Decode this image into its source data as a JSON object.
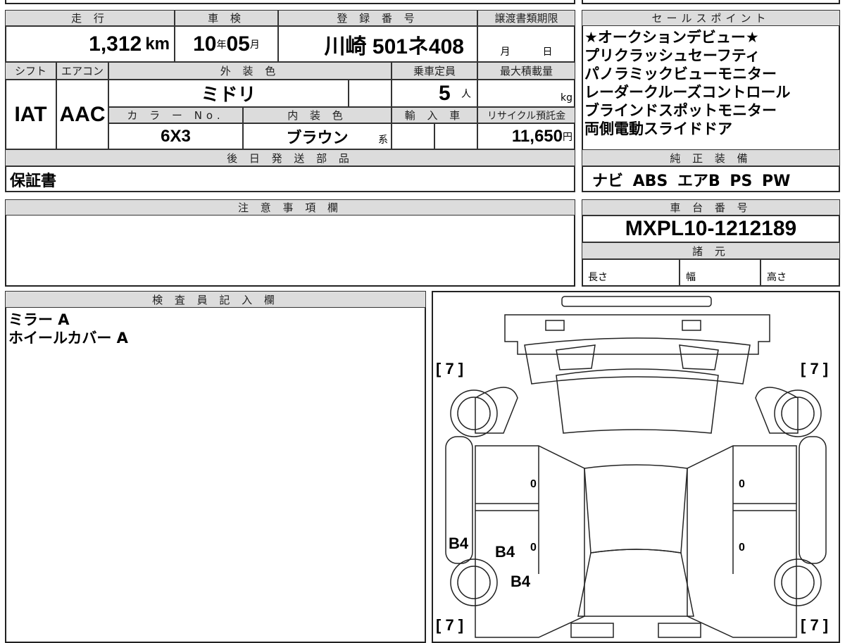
{
  "main": {
    "mileage_label": "走 行",
    "mileage": "1,312",
    "mileage_unit": "km",
    "inspection_label": "車 検",
    "insp_year": "10",
    "year_unit": "年",
    "insp_month": "05",
    "month_unit": "月",
    "plate_label": "登 録 番 号",
    "plate": "川崎 501ネ408",
    "transfer_label": "譲渡書類期限",
    "transfer_month": "月",
    "transfer_day": "日",
    "shift_label": "シフト",
    "shift": "IAT",
    "ac_label": "エアコン",
    "ac": "AAC",
    "ext_color_label": "外 装 色",
    "ext_color": "ミドリ",
    "capacity_label": "乗車定員",
    "capacity": "5",
    "capacity_unit": "人",
    "max_load_label": "最大積載量",
    "max_load_unit": "kg",
    "color_no_label": "カ ラ ー No.",
    "color_no": "6X3",
    "int_color_label": "内 装 色",
    "int_color": "ブラウン",
    "int_color_suffix": "系",
    "import_label": "輸 入 車",
    "recycle_label": "リサイクル預託金",
    "recycle": "11,650",
    "recycle_unit": "円",
    "later_parts_label": "後 日 発 送 部 品",
    "later_parts": "保証書"
  },
  "sales": {
    "label": "セールスポイント",
    "points": [
      "★オークションデビュー★",
      "プリクラッシュセーフティ",
      "パノラミックビューモニター",
      "レーダークルーズコントロール",
      "ブラインドスポットモニター",
      "両側電動スライドドア"
    ],
    "equipment_label": "純 正 装 備",
    "equipment": "ナビ ABS エアB PS PW"
  },
  "notes": {
    "label": "注 意 事 項 欄"
  },
  "chassis": {
    "label": "車 台 番 号",
    "value": "MXPL10-1212189",
    "spec_label": "諸 元",
    "length": "長さ",
    "width": "幅",
    "height": "高さ"
  },
  "inspector": {
    "label": "検 査 員 記 入 欄",
    "lines": [
      "ミラー A",
      "ホイールカバー A"
    ]
  },
  "diagram": {
    "tire_fl": "[ 7 ]",
    "tire_fr": "[ 7 ]",
    "tire_rl": "[ 7 ]",
    "tire_rr": "[ 7 ]",
    "marks": [
      "B4",
      "B4",
      "B4"
    ],
    "zeros": [
      "0",
      "0",
      "0",
      "0"
    ]
  }
}
